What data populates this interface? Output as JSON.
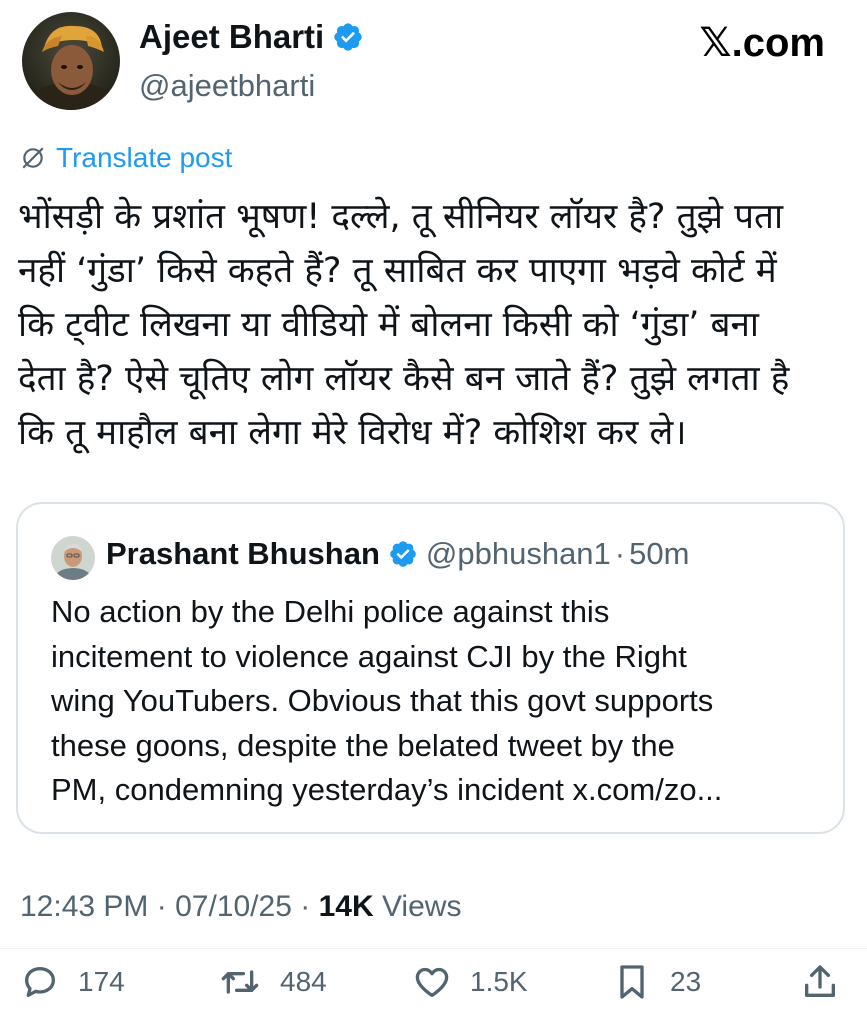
{
  "author": {
    "name": "Ajeet Bharti",
    "handle": "@ajeetbharti"
  },
  "brand": {
    "label": "𝕏.com",
    "icon": "x-logo"
  },
  "translate": {
    "label": "Translate post",
    "icon": "globe-slash-icon"
  },
  "post": {
    "lines": [
      "भोंसड़ी के प्रशांत भूषण! दल्ले, तू सीनियर लॉयर है? तुझे पता",
      "नहीं ‘गुंडा’ किसे कहते हैं? तू साबित कर पाएगा भड़वे कोर्ट में",
      "कि ट्वीट लिखना या वीडियो में बोलना किसी को ‘गुंडा’ बना",
      "देता है? ऐसे चूतिए लोग लॉयर कैसे बन जाते हैं? तुझे लगता है",
      "कि तू माहौल बना लेगा मेरे विरोध में? कोशिश कर ले।"
    ]
  },
  "quote": {
    "name": "Prashant Bhushan",
    "handle": "@pbhushan1",
    "separator": "·",
    "time": "50m",
    "lines": [
      "No action by the Delhi police against this",
      "incitement to violence against CJI by the Right",
      "wing YouTubers. Obvious that this govt supports",
      "these goons, despite the belated tweet by the",
      "PM, condemning yesterday’s incident x.com/zo..."
    ]
  },
  "meta": {
    "time": "12:43 PM",
    "separator": "·",
    "date": "07/10/25",
    "views_count": "14K",
    "views_label": "Views"
  },
  "actions": {
    "replies": "174",
    "reposts": "484",
    "likes": "1.5K",
    "bookmarks": "23"
  },
  "colors": {
    "accent": "#1d9bf0",
    "text": "#0f1419",
    "secondary": "#536471",
    "border": "#dbe2e7"
  }
}
